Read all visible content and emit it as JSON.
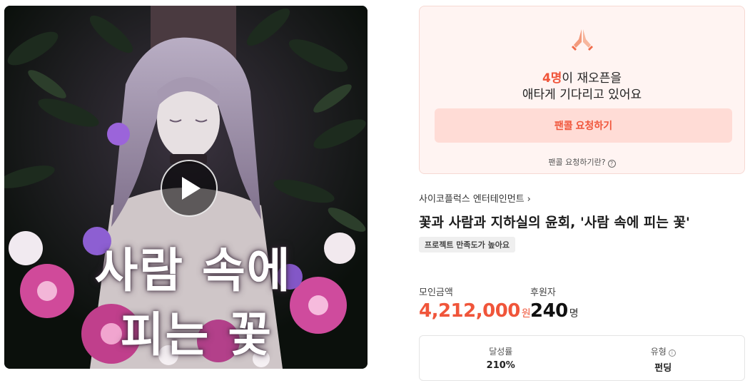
{
  "media": {
    "cover_title_line1": "사람 속에",
    "cover_title_line2": "피는 꽃"
  },
  "encore": {
    "count": "4명",
    "line1_suffix": "이 재오픈을",
    "line2": "애타게 기다리고 있어요",
    "button_label": "팬콜 요청하기",
    "help_text": "팬콜 요청하기란?",
    "help_icon": "question-circle-icon"
  },
  "project": {
    "creator": "사이코플럭스 엔터테인먼트",
    "title": "꽃과 사람과 지하실의 윤회, '사람 속에 피는 꽃'",
    "badge": "프로젝트 만족도가 높아요"
  },
  "stats": {
    "amount_label": "모인금액",
    "amount_value": "4,212,000",
    "amount_unit": "원",
    "backers_label": "후원자",
    "backers_value": "240",
    "backers_unit": "명"
  },
  "info": {
    "rate_label": "달성률",
    "rate_value": "210%",
    "type_label": "유형",
    "type_value": "펀딩",
    "type_icon": "info-circle-icon"
  },
  "colors": {
    "accent": "#f0553a",
    "card_bg": "#fff4f2",
    "button_bg": "#ffdcd6"
  }
}
